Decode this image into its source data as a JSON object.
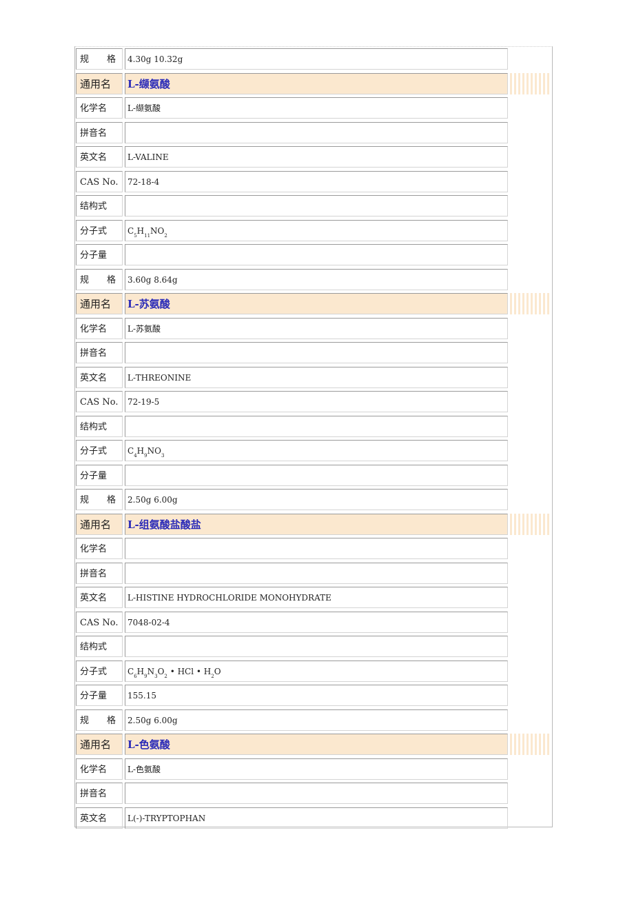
{
  "rows": [
    {
      "type": "field",
      "label": "规　　格",
      "value": "4.30g 10.32g"
    },
    {
      "type": "header",
      "label": "通用名",
      "value": "L-缬氨酸"
    },
    {
      "type": "field",
      "label": "化学名",
      "value": "L-缬氨酸"
    },
    {
      "type": "field",
      "label": "拼音名",
      "value": ""
    },
    {
      "type": "field",
      "label": "英文名",
      "value": "L-VALINE"
    },
    {
      "type": "field",
      "label": "CAS No.",
      "value": "72-18-4"
    },
    {
      "type": "field",
      "label": "结构式",
      "value": ""
    },
    {
      "type": "formula",
      "label": "分子式",
      "value": "C5H11NO2",
      "parts": [
        [
          "C",
          "5"
        ],
        [
          "H",
          "11"
        ],
        [
          "NO",
          "2"
        ]
      ]
    },
    {
      "type": "field",
      "label": "分子量",
      "value": ""
    },
    {
      "type": "field",
      "label": "规　　格",
      "value": "3.60g 8.64g"
    },
    {
      "type": "header",
      "label": "通用名",
      "value": "L-苏氨酸"
    },
    {
      "type": "field",
      "label": "化学名",
      "value": "L-苏氨酸"
    },
    {
      "type": "field",
      "label": "拼音名",
      "value": ""
    },
    {
      "type": "field",
      "label": "英文名",
      "value": "L-THREONINE"
    },
    {
      "type": "field",
      "label": "CAS No.",
      "value": "72-19-5"
    },
    {
      "type": "field",
      "label": "结构式",
      "value": ""
    },
    {
      "type": "formula",
      "label": "分子式",
      "value": "C4H9NO3",
      "parts": [
        [
          "C",
          "4"
        ],
        [
          "H",
          "9"
        ],
        [
          "NO",
          "3"
        ]
      ]
    },
    {
      "type": "field",
      "label": "分子量",
      "value": ""
    },
    {
      "type": "field",
      "label": "规　　格",
      "value": "2.50g 6.00g"
    },
    {
      "type": "header",
      "label": "通用名",
      "value": "L-组氨酸盐酸盐"
    },
    {
      "type": "field",
      "label": "化学名",
      "value": ""
    },
    {
      "type": "field",
      "label": "拼音名",
      "value": ""
    },
    {
      "type": "field",
      "label": "英文名",
      "value": "L-HISTINE HYDROCHLORIDE MONOHYDRATE"
    },
    {
      "type": "field",
      "label": "CAS No.",
      "value": "7048-02-4"
    },
    {
      "type": "field",
      "label": "结构式",
      "value": ""
    },
    {
      "type": "formula",
      "label": "分子式",
      "value": "C6H9N3O2·HCl·H2O",
      "parts": [
        [
          "C",
          "6"
        ],
        [
          "H",
          "9"
        ],
        [
          "N",
          "3"
        ],
        [
          "O",
          "2"
        ],
        [
          " • HCl • H",
          "2"
        ],
        [
          "O",
          ""
        ]
      ]
    },
    {
      "type": "field",
      "label": "分子量",
      "value": "155.15"
    },
    {
      "type": "field",
      "label": "规　　格",
      "value": "2.50g 6.00g"
    },
    {
      "type": "header",
      "label": "通用名",
      "value": "L-色氨酸"
    },
    {
      "type": "field",
      "label": "化学名",
      "value": "L-色氨酸"
    },
    {
      "type": "field",
      "label": "拼音名",
      "value": ""
    },
    {
      "type": "field",
      "label": "英文名",
      "value": "L(-)-TRYPTOPHAN"
    }
  ]
}
